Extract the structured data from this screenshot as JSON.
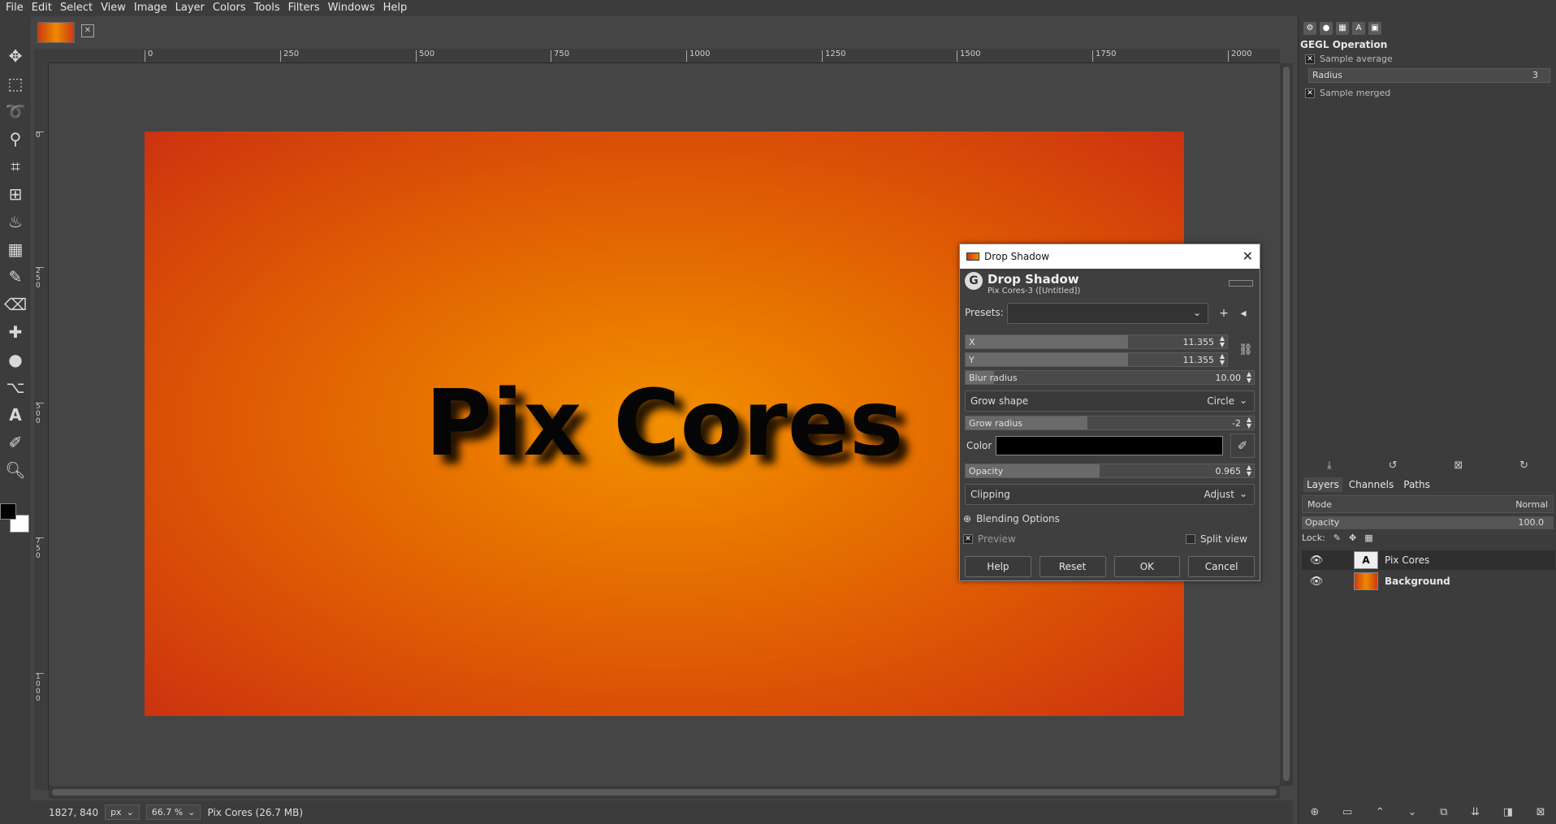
{
  "menu": [
    "File",
    "Edit",
    "Select",
    "View",
    "Image",
    "Layer",
    "Colors",
    "Tools",
    "Filters",
    "Windows",
    "Help"
  ],
  "canvas": {
    "text": "Pix Cores",
    "ruler_ticks": [
      "0",
      "250",
      "500",
      "750",
      "1000",
      "1250",
      "1500",
      "1750",
      "2000"
    ],
    "vruler_ticks": [
      "0",
      "250",
      "500",
      "750",
      "1000"
    ]
  },
  "status": {
    "coords": "1827, 840",
    "unit": "px",
    "zoom": "66.7 %",
    "info": "Pix Cores (26.7 MB)"
  },
  "dock": {
    "gegl_title": "GEGL Operation",
    "sample_average": "Sample average",
    "radius_label": "Radius",
    "radius_value": "3",
    "sample_merged": "Sample merged"
  },
  "layers_panel": {
    "tabs": [
      "Layers",
      "Channels",
      "Paths"
    ],
    "mode_label": "Mode",
    "mode_value": "Normal",
    "opacity_label": "Opacity",
    "opacity_value": "100.0",
    "lock_label": "Lock:",
    "layers": [
      {
        "name": "Pix Cores"
      },
      {
        "name": "Background"
      }
    ]
  },
  "dialog": {
    "window_title": "Drop Shadow",
    "heading": "Drop Shadow",
    "subheading": "Pix Cores-3 ([Untitled])",
    "presets_label": "Presets:",
    "x_label": "X",
    "x_value": "11.355",
    "y_label": "Y",
    "y_value": "11.355",
    "blur_label": "Blur radius",
    "blur_value": "10.00",
    "grow_shape_label": "Grow shape",
    "grow_shape_value": "Circle",
    "grow_radius_label": "Grow radius",
    "grow_radius_value": "-2",
    "color_label": "Color",
    "color_value": "#000000",
    "opacity_label": "Opacity",
    "opacity_value": "0.965",
    "clipping_label": "Clipping",
    "clipping_value": "Adjust",
    "blending_label": "Blending Options",
    "preview_label": "Preview",
    "split_view_label": "Split view",
    "buttons": {
      "help": "Help",
      "reset": "Reset",
      "ok": "OK",
      "cancel": "Cancel"
    }
  }
}
